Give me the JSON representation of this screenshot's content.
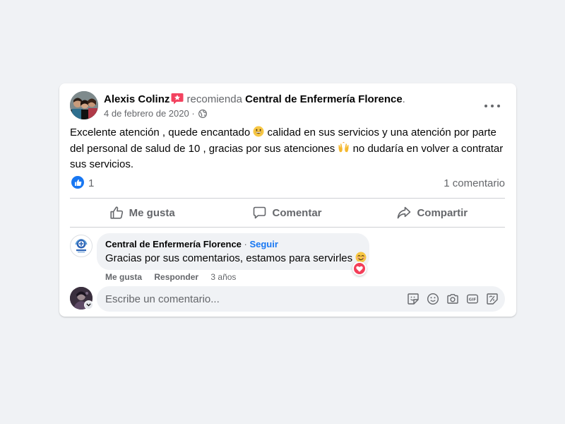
{
  "post": {
    "author": "Alexis Colinz",
    "verb": "recomienda",
    "target": "Central de Enfermería Florence",
    "date": "4 de febrero de 2020",
    "text_1": "Excelente atención , quede encantado ",
    "emoji_1": "grinning-face-emoji",
    "text_2": " calidad en sus servicios y una atención por parte del personal de salud de 10 , gracias por sus atenciones ",
    "emoji_2": "raising-hands-emoji",
    "text_3": " no dudaría en volver a contratar sus servicios."
  },
  "stats": {
    "reaction": "like-icon",
    "likes": "1",
    "comments": "1 comentario"
  },
  "actions": {
    "like": "Me gusta",
    "comment": "Comentar",
    "share": "Compartir"
  },
  "comment": {
    "author": "Central de Enfermería Florence",
    "separator": " · ",
    "follow": "Seguir",
    "text": "Gracias por sus comentarios, estamos para servirles ",
    "emoji": "smiling-face-emoji",
    "reaction": "heart-icon",
    "like": "Me gusta",
    "reply": "Responder",
    "age": "3 años"
  },
  "composer": {
    "placeholder": "Escribe un comentario...",
    "icons": [
      "sticker-icon",
      "emoji-icon",
      "camera-icon",
      "gif-icon",
      "avatar-sticker-icon"
    ]
  },
  "colors": {
    "background": "#f0f2f5",
    "card": "#ffffff",
    "primary_text": "#050505",
    "secondary_text": "#65676b",
    "accent": "#1877f2",
    "love": "#f33e58",
    "recommend_badge": "#f3425f"
  }
}
